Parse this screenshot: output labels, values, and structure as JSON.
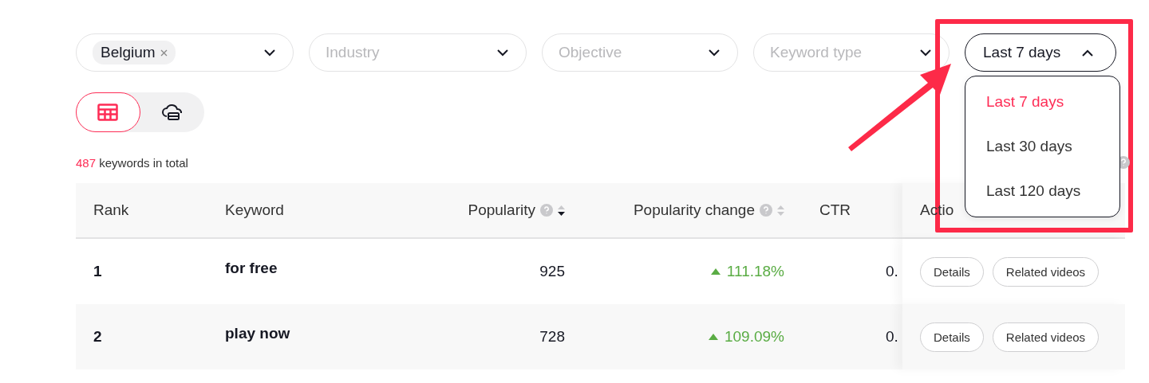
{
  "filters": [
    {
      "kind": "tag",
      "tag": "Belgium"
    },
    {
      "kind": "placeholder",
      "placeholder": "Industry"
    },
    {
      "kind": "placeholder",
      "placeholder": "Objective"
    },
    {
      "kind": "placeholder",
      "placeholder": "Keyword type"
    }
  ],
  "date_select": {
    "value": "Last 7 days",
    "expanded": true,
    "options": [
      {
        "label": "Last 7 days",
        "selected": true
      },
      {
        "label": "Last 30 days",
        "selected": false
      },
      {
        "label": "Last 120 days",
        "selected": false
      }
    ]
  },
  "view_toggle": [
    {
      "kind": "table",
      "selected": true
    },
    {
      "kind": "cloud",
      "selected": false
    }
  ],
  "total": {
    "count": "487",
    "label": "keywords in total"
  },
  "table": {
    "columns": [
      {
        "label": "Rank"
      },
      {
        "label": "Keyword"
      },
      {
        "label": "Popularity",
        "help": true,
        "sortable": true,
        "sorted": true
      },
      {
        "label": "Popularity change",
        "help": true,
        "sortable": true,
        "sorted": false
      },
      {
        "label": "CTR"
      },
      {
        "label": "Actio"
      }
    ],
    "rows": [
      {
        "rank": "1",
        "keyword": "for free",
        "popularity": "925",
        "change": {
          "increase": true,
          "text": "111.18%"
        },
        "ctr": "0.",
        "actions": [
          "Details",
          "Related videos"
        ]
      },
      {
        "rank": "2",
        "keyword": "play now",
        "popularity": "728",
        "change": {
          "increase": true,
          "text": "109.09%"
        },
        "ctr": "0.",
        "actions": [
          "Details",
          "Related videos"
        ]
      }
    ]
  }
}
